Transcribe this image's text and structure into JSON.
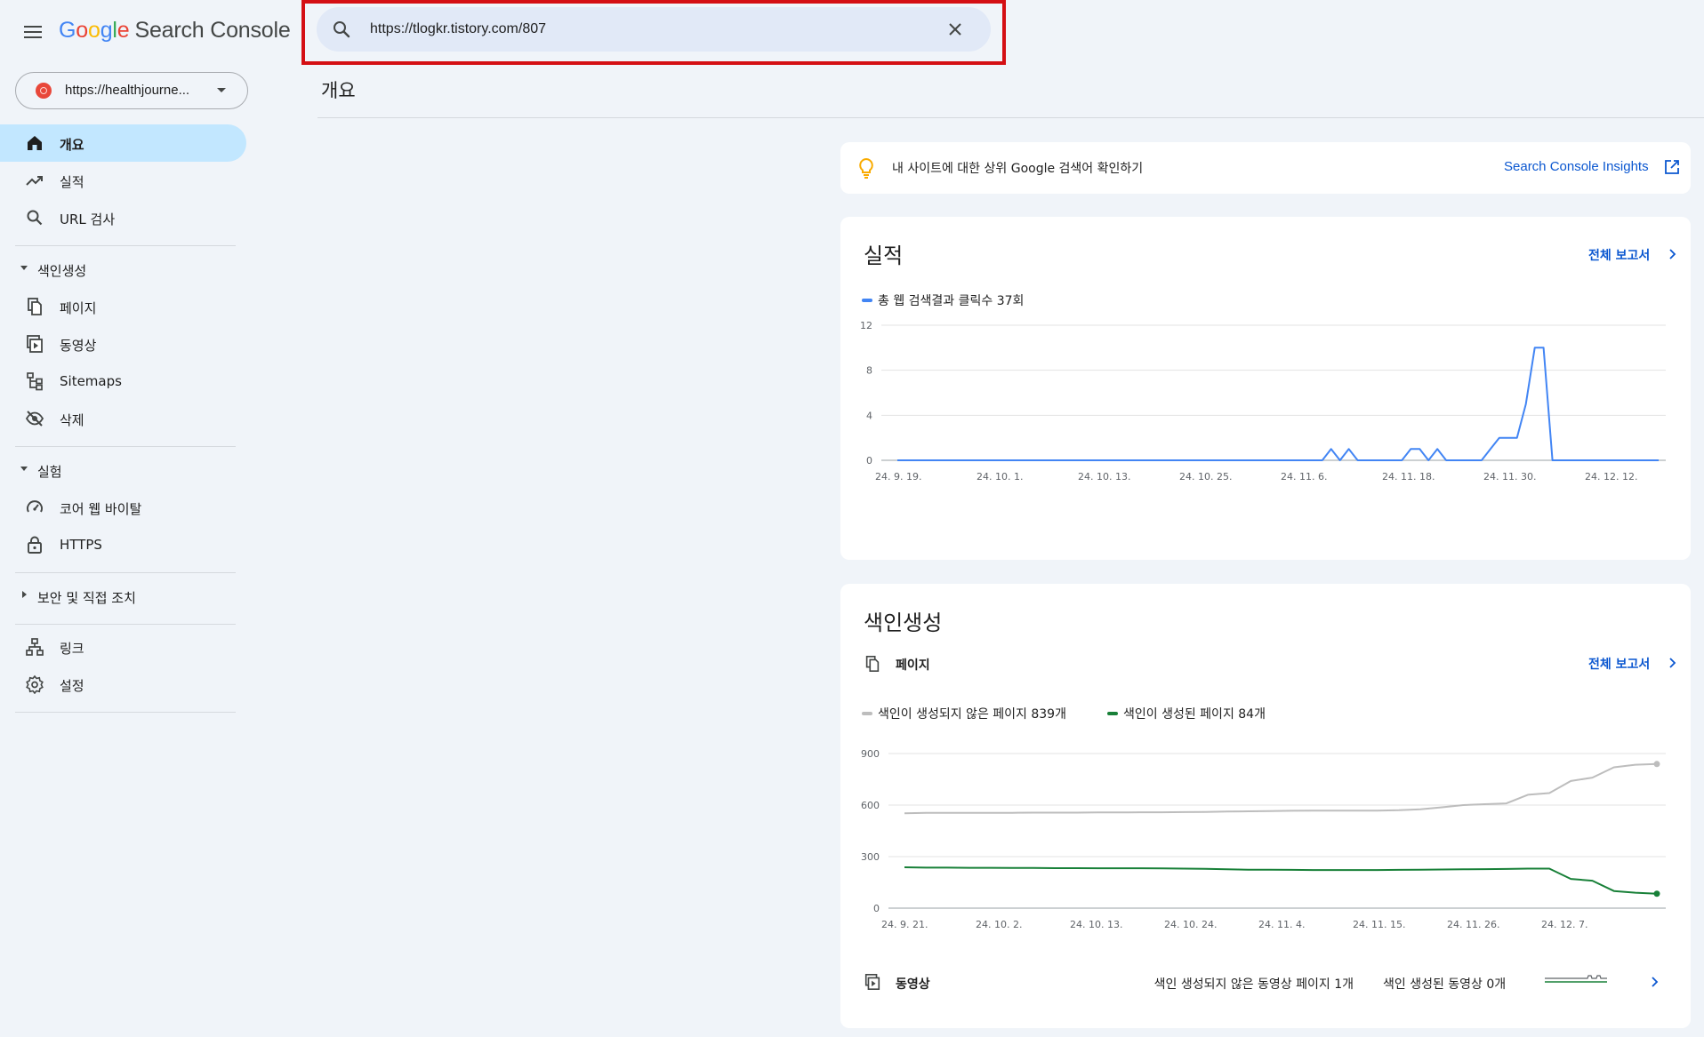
{
  "app": {
    "logo_google": [
      "G",
      "o",
      "o",
      "g",
      "l",
      "e"
    ],
    "logo_product": "Search Console"
  },
  "search": {
    "value": "https://tlogkr.tistory.com/807"
  },
  "property": {
    "label": "https://healthjourne..."
  },
  "sidebar": {
    "items": [
      {
        "label": "개요",
        "icon": "home-icon"
      },
      {
        "label": "실적",
        "icon": "trending-up-icon"
      },
      {
        "label": "URL 검사",
        "icon": "search-icon"
      }
    ],
    "section_indexing": "색인생성",
    "indexing_items": [
      {
        "label": "페이지",
        "icon": "pages-icon"
      },
      {
        "label": "동영상",
        "icon": "video-pages-icon"
      },
      {
        "label": "Sitemaps",
        "icon": "sitemap-icon"
      },
      {
        "label": "삭제",
        "icon": "visibility-off-icon"
      }
    ],
    "section_experience": "실험",
    "experience_items": [
      {
        "label": "코어 웹 바이탈",
        "icon": "speed-icon"
      },
      {
        "label": "HTTPS",
        "icon": "lock-icon"
      }
    ],
    "section_security": "보안 및 직접 조치",
    "bottom_items": [
      {
        "label": "링크",
        "icon": "links-icon"
      },
      {
        "label": "설정",
        "icon": "settings-icon"
      }
    ]
  },
  "main": {
    "title": "개요",
    "insight_text": "내 사이트에 대한 상위 Google 검색어 확인하기",
    "insight_link": "Search Console Insights",
    "performance": {
      "title": "실적",
      "full_report": "전체 보고서",
      "legend": "총 웹 검색결과 클릭수 37회"
    },
    "indexing": {
      "title": "색인생성",
      "subsection": "페이지",
      "full_report": "전체 보고서",
      "legend_not_indexed": "색인이 생성되지 않은 페이지 839개",
      "legend_indexed": "색인이 생성된 페이지 84개",
      "video_label": "동영상",
      "video_not_indexed": "색인 생성되지 않은 동영상 페이지 1개",
      "video_indexed": "색인 생성된 동영상 0개"
    }
  },
  "colors": {
    "clicks": "#4285f4",
    "not_indexed": "#bdbdbd",
    "indexed": "#188038",
    "link": "#0b57d0",
    "highlight": "#d40f14"
  },
  "chart_data": [
    {
      "type": "line",
      "title": "",
      "xlabel": "",
      "ylabel": "",
      "ylim": [
        0,
        12
      ],
      "yticks": [
        0,
        4,
        8,
        12
      ],
      "xtick_labels": [
        "24. 9. 19.",
        "24. 10. 1.",
        "24. 10. 13.",
        "24. 10. 25.",
        "24. 11. 6.",
        "24. 11. 18.",
        "24. 11. 30.",
        "24. 12. 12."
      ],
      "series": [
        {
          "name": "총 웹 검색결과 클릭수 37회",
          "color": "#4285f4",
          "values": [
            0,
            0,
            0,
            0,
            0,
            0,
            0,
            0,
            0,
            0,
            0,
            0,
            0,
            0,
            0,
            0,
            0,
            0,
            0,
            0,
            0,
            0,
            0,
            0,
            0,
            0,
            0,
            0,
            0,
            0,
            0,
            0,
            0,
            0,
            0,
            0,
            0,
            0,
            0,
            0,
            0,
            0,
            0,
            0,
            0,
            0,
            0,
            0,
            0,
            1,
            0,
            1,
            0,
            0,
            0,
            0,
            0,
            0,
            1,
            1,
            0,
            1,
            0,
            0,
            0,
            0,
            0,
            1,
            2,
            2,
            2,
            5,
            10,
            10,
            0,
            0,
            0,
            0,
            0,
            0,
            0,
            0,
            0,
            0,
            0,
            0,
            0
          ]
        }
      ]
    },
    {
      "type": "line",
      "title": "",
      "xlabel": "",
      "ylabel": "",
      "ylim": [
        0,
        900
      ],
      "yticks": [
        0,
        300,
        600,
        900
      ],
      "xtick_labels": [
        "24. 9. 21.",
        "24. 10. 2.",
        "24. 10. 13.",
        "24. 10. 24.",
        "24. 11. 4.",
        "24. 11. 15.",
        "24. 11. 26.",
        "24. 12. 7."
      ],
      "series": [
        {
          "name": "색인이 생성되지 않은 페이지 839개",
          "color": "#bdbdbd",
          "values": [
            552,
            555,
            555,
            555,
            555,
            555,
            556,
            556,
            556,
            557,
            557,
            558,
            558,
            559,
            560,
            562,
            564,
            565,
            567,
            568,
            568,
            568,
            568,
            570,
            575,
            587,
            600,
            605,
            610,
            660,
            670,
            740,
            760,
            820,
            835,
            839
          ]
        },
        {
          "name": "색인이 생성된 페이지 84개",
          "color": "#188038",
          "values": [
            238,
            236,
            236,
            235,
            235,
            234,
            234,
            233,
            233,
            232,
            232,
            232,
            231,
            230,
            229,
            226,
            224,
            224,
            223,
            222,
            222,
            222,
            222,
            223,
            224,
            225,
            226,
            227,
            228,
            230,
            230,
            170,
            160,
            100,
            90,
            84
          ]
        }
      ]
    }
  ]
}
